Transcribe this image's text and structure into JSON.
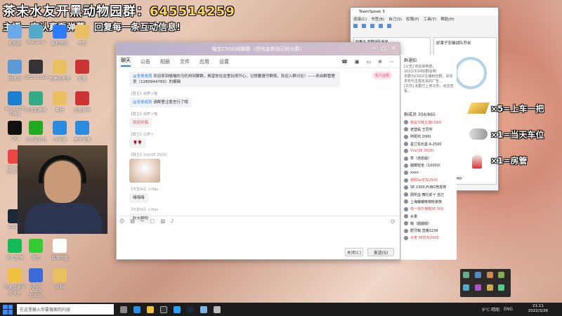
{
  "overlay": {
    "line1_prefix": "茶末水友开黑动物园群：",
    "line1_number": "645514259",
    "line2": "主播一定认真看弹幕，回复每一条互动信息!"
  },
  "desktop_icons": [
    {
      "label": "此电脑"
    },
    {
      "label": "WeGame"
    },
    {
      "label": "酷狗音乐"
    },
    {
      "label": "资料"
    },
    {
      "label": "回收站"
    },
    {
      "label": "OBS Studio"
    },
    {
      "label": "新建文件夹"
    },
    {
      "label": "直播"
    },
    {
      "label": "Microsoft Edge"
    },
    {
      "label": "迅游加速器"
    },
    {
      "label": "素材"
    },
    {
      "label": "完美世界"
    },
    {
      "label": "QQ"
    },
    {
      "label": "360安全卫士"
    },
    {
      "label": "YY开播"
    },
    {
      "label": "虎牙直播"
    },
    {
      "label": "Google Chrome"
    },
    {
      "label": "Steam"
    },
    {
      "label": "万代蓝牌"
    },
    {
      "label": "微信"
    },
    {
      "label": "百度网盘"
    },
    {
      "label": "完美世界竞技平台"
    },
    {
      "label": "Ottre Video Studio"
    },
    {
      "label": "文档"
    }
  ],
  "chat": {
    "title": "喵宝CSGO闲聊群（但也会有自己的分群）",
    "tabs": [
      "聊天",
      "公告",
      "相册",
      "文件",
      "应用",
      "设置"
    ],
    "announcement_label": "有人@我",
    "messages": [
      {
        "name": "",
        "text_link": "@全体成员",
        "text": " 欢迎来到喵喵的乌托邦闲聊群，希望你在这里玩得开心，记得要遵守群规，欢迎入群讨论！——来自群管理员（1280944780）的编辑"
      },
      {
        "name": "【群主】胡萝卜喵",
        "text_link": "@全体成员",
        "text": " 请群里注意言行了哦"
      },
      {
        "name": "【群主】胡萝卜喵",
        "text_link": "",
        "text": "欢迎光临"
      },
      {
        "name": "【群主】白萝卜",
        "text_link": "",
        "text": "🌹🌹"
      },
      {
        "name": "【群主】Vce(SE 2500)",
        "text_link": "",
        "text": "[图片]"
      },
      {
        "name": "【可爱hh】小Hao",
        "text_link": "",
        "text": "嗨嗨嗨"
      },
      {
        "name": "【可爱hh】小Hao",
        "text_link": "",
        "text": "好无聊啦"
      }
    ],
    "close_button": "关闭(C)",
    "send_button": "发送(S)"
  },
  "side": {
    "notice_title": "群通知",
    "notice_text": "[公告] 欢迎来到群，2022/3/24加群说明\n本群为CSGO主播粉丝群，请勿发布与主题无关的广告...\n[文件] 本群已上传文件，点击查看...",
    "member_title": "群成员 304/865",
    "members": [
      "我是今晚主播CSGO",
      "老登般 王同学",
      "阿斑鸠 2000",
      "墨兰花石墨 A-2500",
      "Vce(SE 2500)",
      "乖（自愿版）",
      "腿脚轻坐（10000）",
      "xxxx",
      "渡鸦Se优先2500",
      "SE 2300,PUBG竞技排",
      "厕所虫 舞社前十 自己",
      "上海蛐蛐吸咖哈家族",
      "电一饱牛拥抱SE 500",
      "水果",
      "翰（腿腿版）",
      "肥牙翰 直播1234",
      "大佬 SE优先2500"
    ]
  },
  "teamspeak": {
    "title": "TeamSpeak 3",
    "menu": [
      "连接(C)",
      "书签(B)",
      "自己(S)",
      "权限(P)",
      "工具(T)",
      "帮助(H)"
    ],
    "server": "好莱子 安徽战队乔米",
    "info_title": "好莱子安徽战队乔米",
    "connection": "连接到: jiangy"
  },
  "badges": [
    {
      "text": "×5=上车一把"
    },
    {
      "text": "×1=当天车位"
    },
    {
      "text": "×1=房管"
    }
  ],
  "taskbar": {
    "search_placeholder": "在这里输入你要搜索的内容",
    "temp": "9°C 晴朗",
    "lang": "ENG",
    "time": "21:11",
    "date": "2022/3/26"
  }
}
